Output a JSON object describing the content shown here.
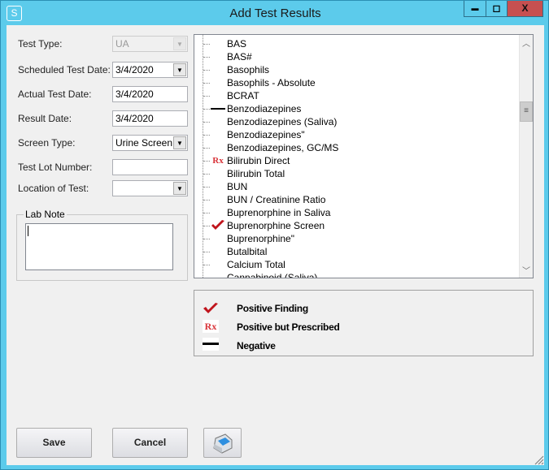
{
  "window": {
    "title": "Add Test Results",
    "app_icon": "S",
    "minimize": "▬",
    "maximize": "◻",
    "close": "X"
  },
  "form": {
    "test_type": {
      "label": "Test Type:",
      "value": "UA"
    },
    "scheduled_date": {
      "label": "Scheduled Test Date:",
      "value": "3/4/2020"
    },
    "actual_date": {
      "label": "Actual Test Date:",
      "value": "3/4/2020"
    },
    "result_date": {
      "label": "Result Date:",
      "value": "3/4/2020"
    },
    "screen_type": {
      "label": "Screen Type:",
      "value": "Urine Screen"
    },
    "lot_number": {
      "label": "Test Lot Number:",
      "value": ""
    },
    "location": {
      "label": "Location of Test:",
      "value": ""
    },
    "lab_note": {
      "label": "Lab Note",
      "value": ""
    }
  },
  "tests": [
    {
      "name": "BAS",
      "marker": "none"
    },
    {
      "name": "BAS#",
      "marker": "none"
    },
    {
      "name": "Basophils",
      "marker": "none"
    },
    {
      "name": "Basophils - Absolute",
      "marker": "none"
    },
    {
      "name": "BCRAT",
      "marker": "none"
    },
    {
      "name": "Benzodiazepines",
      "marker": "negative"
    },
    {
      "name": "Benzodiazepines (Saliva)",
      "marker": "none"
    },
    {
      "name": "Benzodiazepines\"",
      "marker": "none"
    },
    {
      "name": "Benzodiazepines, GC/MS",
      "marker": "none"
    },
    {
      "name": "Bilirubin Direct",
      "marker": "prescribed"
    },
    {
      "name": "Bilirubin Total",
      "marker": "none"
    },
    {
      "name": "BUN",
      "marker": "none"
    },
    {
      "name": "BUN / Creatinine Ratio",
      "marker": "none"
    },
    {
      "name": "Buprenorphine in Saliva",
      "marker": "none"
    },
    {
      "name": "Buprenorphine Screen",
      "marker": "positive"
    },
    {
      "name": "Buprenorphine\"",
      "marker": "none"
    },
    {
      "name": "Butalbital",
      "marker": "none"
    },
    {
      "name": "Calcium Total",
      "marker": "none"
    },
    {
      "name": "Cannabinoid (Saliva)",
      "marker": "none"
    }
  ],
  "legend": {
    "positive": "Positive Finding",
    "prescribed": "Positive but Prescribed",
    "negative": "Negative",
    "rx": "Rx"
  },
  "buttons": {
    "save": "Save",
    "cancel": "Cancel"
  },
  "colors": {
    "titlebar": "#5ccbeb",
    "close": "#c75050",
    "check": "#c0141c",
    "rx": "#d9343a"
  }
}
